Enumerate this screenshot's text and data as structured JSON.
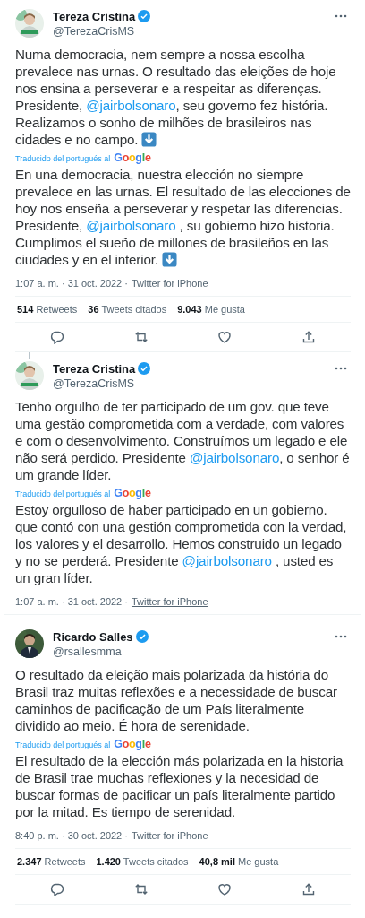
{
  "tweets": [
    {
      "connected_above": false,
      "author": {
        "name": "Tereza Cristina",
        "verified": true,
        "handle": "@TerezaCrisMS"
      },
      "text": [
        {
          "kind": "plain",
          "text": "Numa democracia, nem sempre a nossa escolha prevalece nas urnas. O resultado das eleições de hoje nos ensina a perseverar e a respeitar as diferenças. Presidente, "
        },
        {
          "kind": "mention",
          "text": "@jairbolsonaro"
        },
        {
          "kind": "plain",
          "text": ", seu governo fez história. Realizamos o sonho de milhões de brasileiros nas cidades e no campo. "
        },
        {
          "kind": "arrow-emoji"
        }
      ],
      "translation_note": {
        "label": "Traducido del portugués al",
        "brand": "Google"
      },
      "translation": [
        {
          "kind": "plain",
          "text": "En una democracia, nuestra elección no siempre prevalece en las urnas. El resultado de las elecciones de hoy nos enseña a perseverar y respetar las diferencias. Presidente, "
        },
        {
          "kind": "mention",
          "text": "@jairbolsonaro"
        },
        {
          "kind": "plain",
          "text": " , su gobierno hizo historia. Cumplimos el sueño de millones de brasileños en las ciudades y en el interior. "
        },
        {
          "kind": "arrow-emoji"
        }
      ],
      "meta": {
        "timestamp": "1:07 a. m. · 31 oct. 2022 ·",
        "source": "Twitter for iPhone",
        "hovered": false
      },
      "stats": [
        {
          "count": "514",
          "label": "Retweets"
        },
        {
          "count": "36",
          "label": "Tweets citados"
        },
        {
          "count": "9.043",
          "label": "Me gusta"
        }
      ],
      "actions": [
        {
          "kind": "reply"
        },
        {
          "kind": "retweet"
        },
        {
          "kind": "like"
        },
        {
          "kind": "share"
        }
      ]
    },
    {
      "connected_above": true,
      "author": {
        "name": "Tereza Cristina",
        "verified": true,
        "handle": "@TerezaCrisMS"
      },
      "text": [
        {
          "kind": "plain",
          "text": "Tenho orgulho de ter participado de um gov. que teve uma gestão comprometida com a verdade, com valores e com o desenvolvimento. Construímos um legado e ele não será perdido. Presidente "
        },
        {
          "kind": "mention",
          "text": "@jairbolsonaro"
        },
        {
          "kind": "plain",
          "text": ", o senhor é um grande líder."
        }
      ],
      "translation_note": {
        "label": "Traducido del portugués al",
        "brand": "Google"
      },
      "translation": [
        {
          "kind": "plain",
          "text": "Estoy orgulloso de haber participado en un gobierno. que contó con una gestión comprometida con la verdad, los valores y el desarrollo. Hemos construido un legado y no se perderá. Presidente "
        },
        {
          "kind": "mention",
          "text": "@jairbolsonaro"
        },
        {
          "kind": "plain",
          "text": " , usted es un gran líder."
        }
      ],
      "meta": {
        "timestamp": "1:07 a. m. · 31 oct. 2022 ·",
        "source": "Twitter for iPhone",
        "hovered": true
      }
    },
    {
      "connected_above": false,
      "author": {
        "name": "Ricardo Salles",
        "verified": true,
        "handle": "@rsallesmma"
      },
      "text": [
        {
          "kind": "plain",
          "text": "O resultado da eleição mais polarizada da história do Brasil traz muitas reflexões e a necessidade de buscar caminhos de pacificação de um País literalmente dividido ao meio. É hora de serenidade."
        }
      ],
      "translation_note": {
        "label": "Traducido del portugués al",
        "brand": "Google"
      },
      "translation": [
        {
          "kind": "plain",
          "text": "El resultado de la elección más polarizada en la historia de Brasil trae muchas reflexiones y la necesidad de buscar formas de pacificar un país literalmente partido por la mitad. Es tiempo de serenidad."
        }
      ],
      "meta": {
        "timestamp": "8:40 p. m. · 30 oct. 2022 ·",
        "source": "Twitter for iPhone",
        "hovered": false
      },
      "stats": [
        {
          "count": "2.347",
          "label": "Retweets"
        },
        {
          "count": "1.420",
          "label": "Tweets citados"
        },
        {
          "count": "40,8 mil",
          "label": "Me gusta"
        }
      ],
      "actions": [
        {
          "kind": "reply"
        },
        {
          "kind": "retweet"
        },
        {
          "kind": "like"
        },
        {
          "kind": "share"
        }
      ]
    }
  ]
}
